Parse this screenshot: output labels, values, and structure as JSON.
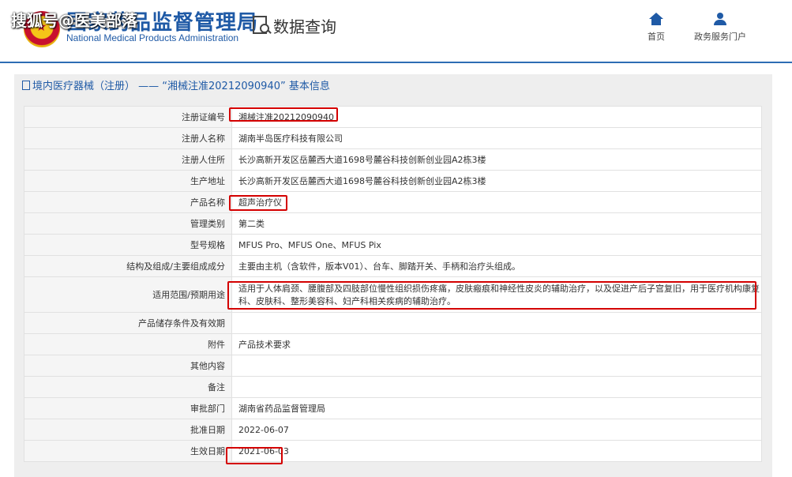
{
  "header": {
    "site_name_cn": "国家药品监督管理局",
    "site_name_en": "National Medical Products Administration",
    "watermark": "搜狐号@医美部落",
    "query_label": "数据查询",
    "nav": [
      {
        "label": "首页",
        "icon": "home-icon"
      },
      {
        "label": "政务服务门户",
        "icon": "user-icon"
      }
    ]
  },
  "panel": {
    "title": "境内医疗器械（注册） —— “湘械注准20212090940” 基本信息"
  },
  "rows": [
    {
      "label": "注册证编号",
      "value": "湘械注准20212090940"
    },
    {
      "label": "注册人名称",
      "value": "湖南半岛医疗科技有限公司"
    },
    {
      "label": "注册人住所",
      "value": "长沙高新开发区岳麓西大道1698号麓谷科技创新创业园A2栋3楼"
    },
    {
      "label": "生产地址",
      "value": "长沙高新开发区岳麓西大道1698号麓谷科技创新创业园A2栋3楼"
    },
    {
      "label": "产品名称",
      "value": "超声治疗仪"
    },
    {
      "label": "管理类别",
      "value": "第二类"
    },
    {
      "label": "型号规格",
      "value": "MFUS Pro、MFUS One、MFUS Pix"
    },
    {
      "label": "结构及组成/主要组成成分",
      "value": "主要由主机（含软件，版本V01）、台车、脚踏开关、手柄和治疗头组成。"
    },
    {
      "label": "适用范围/预期用途",
      "value": "适用于人体肩颈、腰腹部及四肢部位慢性组织损伤疼痛，皮肤瘢痕和神经性皮炎的辅助治疗，以及促进产后子宫复旧，用于医疗机构康复科、皮肤科、整形美容科、妇产科相关疾病的辅助治疗。"
    },
    {
      "label": "产品储存条件及有效期",
      "value": ""
    },
    {
      "label": "附件",
      "value": "产品技术要求"
    },
    {
      "label": "其他内容",
      "value": ""
    },
    {
      "label": "备注",
      "value": ""
    },
    {
      "label": "审批部门",
      "value": "湖南省药品监督管理局"
    },
    {
      "label": "批准日期",
      "value": "2022-06-07"
    },
    {
      "label": "生效日期",
      "value": "2021-06-03"
    }
  ],
  "colors": {
    "brand": "#1f5aa6",
    "highlight": "#d40000"
  }
}
